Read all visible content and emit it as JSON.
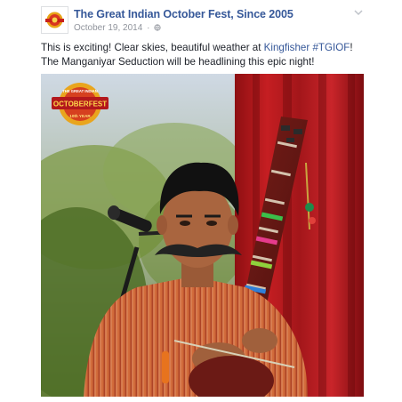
{
  "post": {
    "page_name": "The Great Indian October Fest, Since 2005",
    "date": "October 19, 2014",
    "separator": "·",
    "privacy_icon": "globe-icon",
    "options_icon": "chevron-down-icon",
    "text_before": "This is exciting! Clear skies, beautiful weather at ",
    "mention": "Kingfisher",
    "text_middle": " ",
    "hashtag": "#TGIOF",
    "text_after": "! The Manganiyar Seduction will be headlining this epic night!"
  },
  "photo": {
    "logo_title": "OCTOBERFEST",
    "logo_subtitle": "THE GREAT INDIAN",
    "logo_ribbon": "10th YEAR",
    "colors": {
      "link": "#365899",
      "curtain": "#b3181c",
      "foliage": "#6f8f3a",
      "shirt": "#c9552c"
    }
  }
}
